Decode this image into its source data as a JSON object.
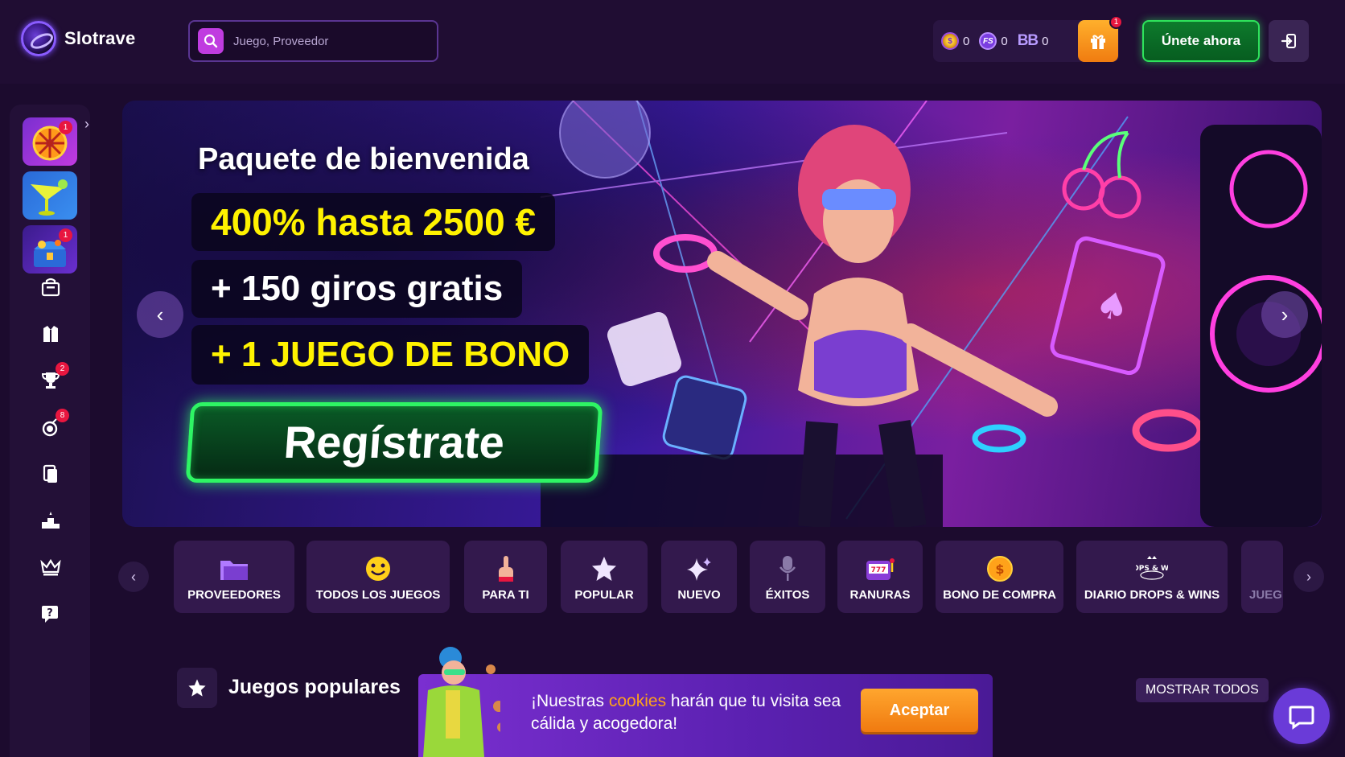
{
  "header": {
    "brand": "Slotrave",
    "search_placeholder": "Juego, Proveedor",
    "balances": [
      {
        "icon": "coin-icon",
        "value": "0"
      },
      {
        "icon": "free-spins-icon",
        "value": "0"
      },
      {
        "label": "BB",
        "value": "0"
      }
    ],
    "gift_badge": "1",
    "join_label": "Únete ahora"
  },
  "sidebar": {
    "badges": {
      "wheel": "1",
      "chest": "1",
      "tournaments": "2",
      "bomb": "8"
    }
  },
  "banner": {
    "title": "Paquete de bienvenida",
    "line1": "400% hasta 2500 €",
    "line2": "+ 150 giros gratis",
    "line3": "+ 1 JUEGO DE BONO",
    "cta": "Regístrate"
  },
  "categories": [
    {
      "label": "PROVEEDORES",
      "icon": "folder-icon"
    },
    {
      "label": "TODOS LOS JUEGOS",
      "icon": "smiley-icon"
    },
    {
      "label": "PARA TI",
      "icon": "pointing-hand-icon"
    },
    {
      "label": "POPULAR",
      "icon": "star-icon"
    },
    {
      "label": "NUEVO",
      "icon": "sparkle-icon"
    },
    {
      "label": "ÉXITOS",
      "icon": "microphone-icon"
    },
    {
      "label": "RANURAS",
      "icon": "slot-machine-icon"
    },
    {
      "label": "BONO DE COMPRA",
      "icon": "dollar-coin-icon"
    },
    {
      "label": "DIARIO DROPS & WINS",
      "icon": "drops-wins-icon",
      "icon_text": "DROPS & WINS"
    },
    {
      "label": "JUEG",
      "icon": "partial-icon"
    }
  ],
  "section": {
    "title": "Juegos populares",
    "show_all": "MOSTRAR TODOS"
  },
  "cookie": {
    "text_before": "¡Nuestras ",
    "highlight": "cookies",
    "text_after": " harán que tu visita sea cálida y acogedora!",
    "accept": "Aceptar"
  },
  "colors": {
    "background": "#1c0b2e",
    "accent_purple": "#c03ce0",
    "cta_green": "#2ef564",
    "promo_yellow": "#fff200",
    "orange": "#f07c10"
  }
}
